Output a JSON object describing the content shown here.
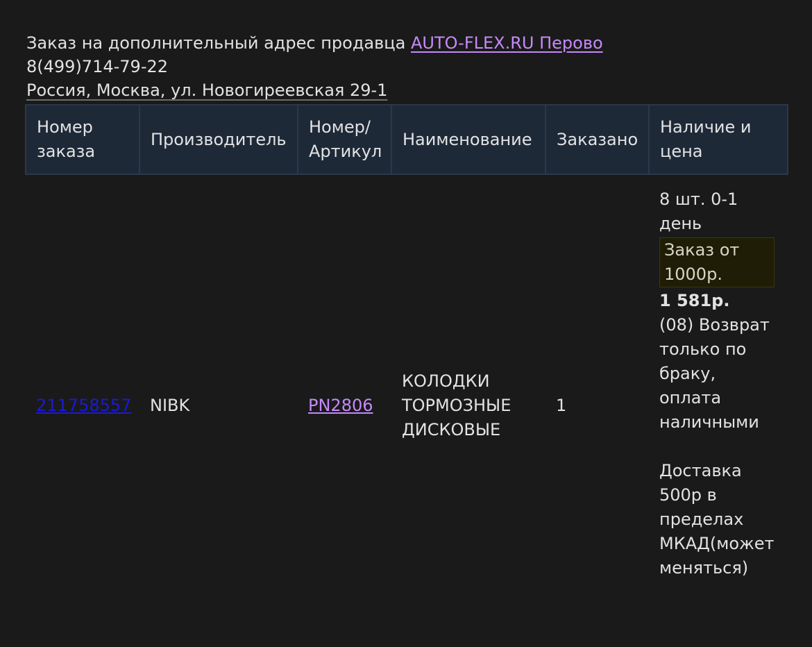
{
  "header": {
    "intro": "Заказ на дополнительный адрес продавца ",
    "seller_name": "AUTO-FLEX.RU Перово",
    "phone": "8(499)714-79-22",
    "address": "Россия, Москва, ул. Новогиреевская 29-1"
  },
  "table": {
    "columns": {
      "order_line1": "Номер",
      "order_line2": "заказа",
      "manufacturer": "Производитель",
      "article_line1": "Номер/",
      "article_line2": "Артикул",
      "name": "Наименование",
      "ordered": "Заказано",
      "avail_line1": "Наличие и",
      "avail_line2": "цена"
    },
    "rows": [
      {
        "order_number": "211758557",
        "manufacturer": "NIBK",
        "article": "PN2806",
        "name_line1": "КОЛОДКИ",
        "name_line2": "ТОРМОЗНЫЕ",
        "name_line3": "ДИСКОВЫЕ",
        "ordered_qty": "1",
        "stock_line1": "8 шт. 0-1",
        "stock_line2": "день",
        "min_order_line1": "Заказ от",
        "min_order_line2": "1000р.",
        "price": "1 581р.",
        "note_lines": [
          "(08) Возврат",
          "только по",
          "браку,",
          "оплата",
          "наличными"
        ],
        "delivery_lines": [
          "Доставка",
          "500р в",
          "пределах",
          "МКАД(может",
          "меняться)"
        ]
      }
    ]
  },
  "colors": {
    "background": "#1a1a1a",
    "header_bg": "#1e2938",
    "link_purple": "#c58af9",
    "link_blue": "#1a1ad6",
    "min_order_bg": "#1f1d06"
  }
}
